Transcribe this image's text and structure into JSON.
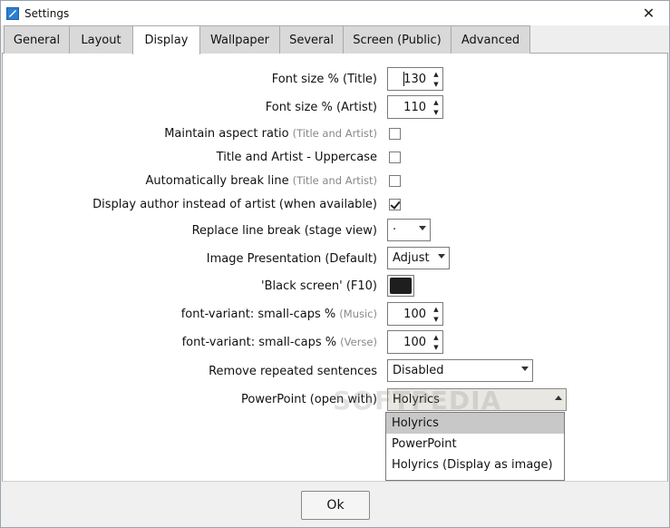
{
  "window": {
    "title": "Settings",
    "close_glyph": "✕"
  },
  "tabs": [
    {
      "label": "General"
    },
    {
      "label": "Layout"
    },
    {
      "label": "Display",
      "active": true
    },
    {
      "label": "Wallpaper"
    },
    {
      "label": "Several"
    },
    {
      "label": "Screen (Public)"
    },
    {
      "label": "Advanced"
    }
  ],
  "display": {
    "font_size_title": {
      "label": "Font size % (Title)",
      "value": "130"
    },
    "font_size_artist": {
      "label": "Font size % (Artist)",
      "value": "110"
    },
    "aspect_ratio": {
      "label": "Maintain aspect ratio",
      "hint": "(Title and Artist)",
      "checked": false
    },
    "uppercase": {
      "label": "Title and Artist - Uppercase",
      "checked": false
    },
    "auto_break": {
      "label": "Automatically break line",
      "hint": "(Title and Artist)",
      "checked": false
    },
    "display_author": {
      "label": "Display author instead of artist (when available)",
      "checked": true
    },
    "replace_line_break": {
      "label": "Replace line break (stage view)",
      "value": "·"
    },
    "image_presentation": {
      "label": "Image Presentation (Default)",
      "value": "Adjust"
    },
    "black_screen": {
      "label": "'Black screen' (F10)",
      "color": "#1e1e1e"
    },
    "small_caps_music": {
      "label": "font-variant: small-caps %",
      "hint": "(Music)",
      "value": "100"
    },
    "small_caps_verse": {
      "label": "font-variant: small-caps %",
      "hint": "(Verse)",
      "value": "100"
    },
    "remove_repeated": {
      "label": "Remove repeated sentences",
      "value": "Disabled"
    },
    "powerpoint": {
      "label": "PowerPoint (open with)",
      "value": "Holyrics",
      "options": [
        "Holyrics",
        "PowerPoint",
        "Holyrics (Display as image)"
      ]
    }
  },
  "watermark": "SOFTPEDIA",
  "footer": {
    "ok_label": "Ok"
  },
  "spinner": {
    "up": "▲",
    "down": "▼"
  }
}
